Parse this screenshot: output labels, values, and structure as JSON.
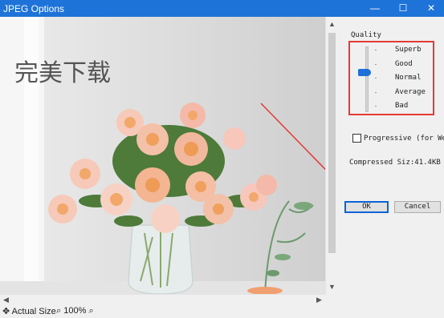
{
  "window": {
    "title": "JPEG Options",
    "min_glyph": "—",
    "max_glyph": "☐",
    "close_glyph": "✕"
  },
  "preview": {
    "watermark_text": "完美下载"
  },
  "options": {
    "quality_label": "Quality",
    "quality_levels": [
      "Superb",
      "Good",
      "Normal",
      "Average",
      "Bad"
    ],
    "selected_quality": "Normal",
    "progressive_label": "Progressive (for Web)",
    "progressive_checked": false,
    "compressed_size_text": "Compressed Siz:41.4KB"
  },
  "buttons": {
    "ok": "OK",
    "cancel": "Cancel"
  },
  "statusbar": {
    "actual_size": "Actual Size",
    "zoom": "100%"
  },
  "colors": {
    "titlebar": "#1e73d8",
    "highlight_box": "#e53935",
    "slider_thumb": "#1e6fd9",
    "ok_border": "#0a64d6"
  }
}
